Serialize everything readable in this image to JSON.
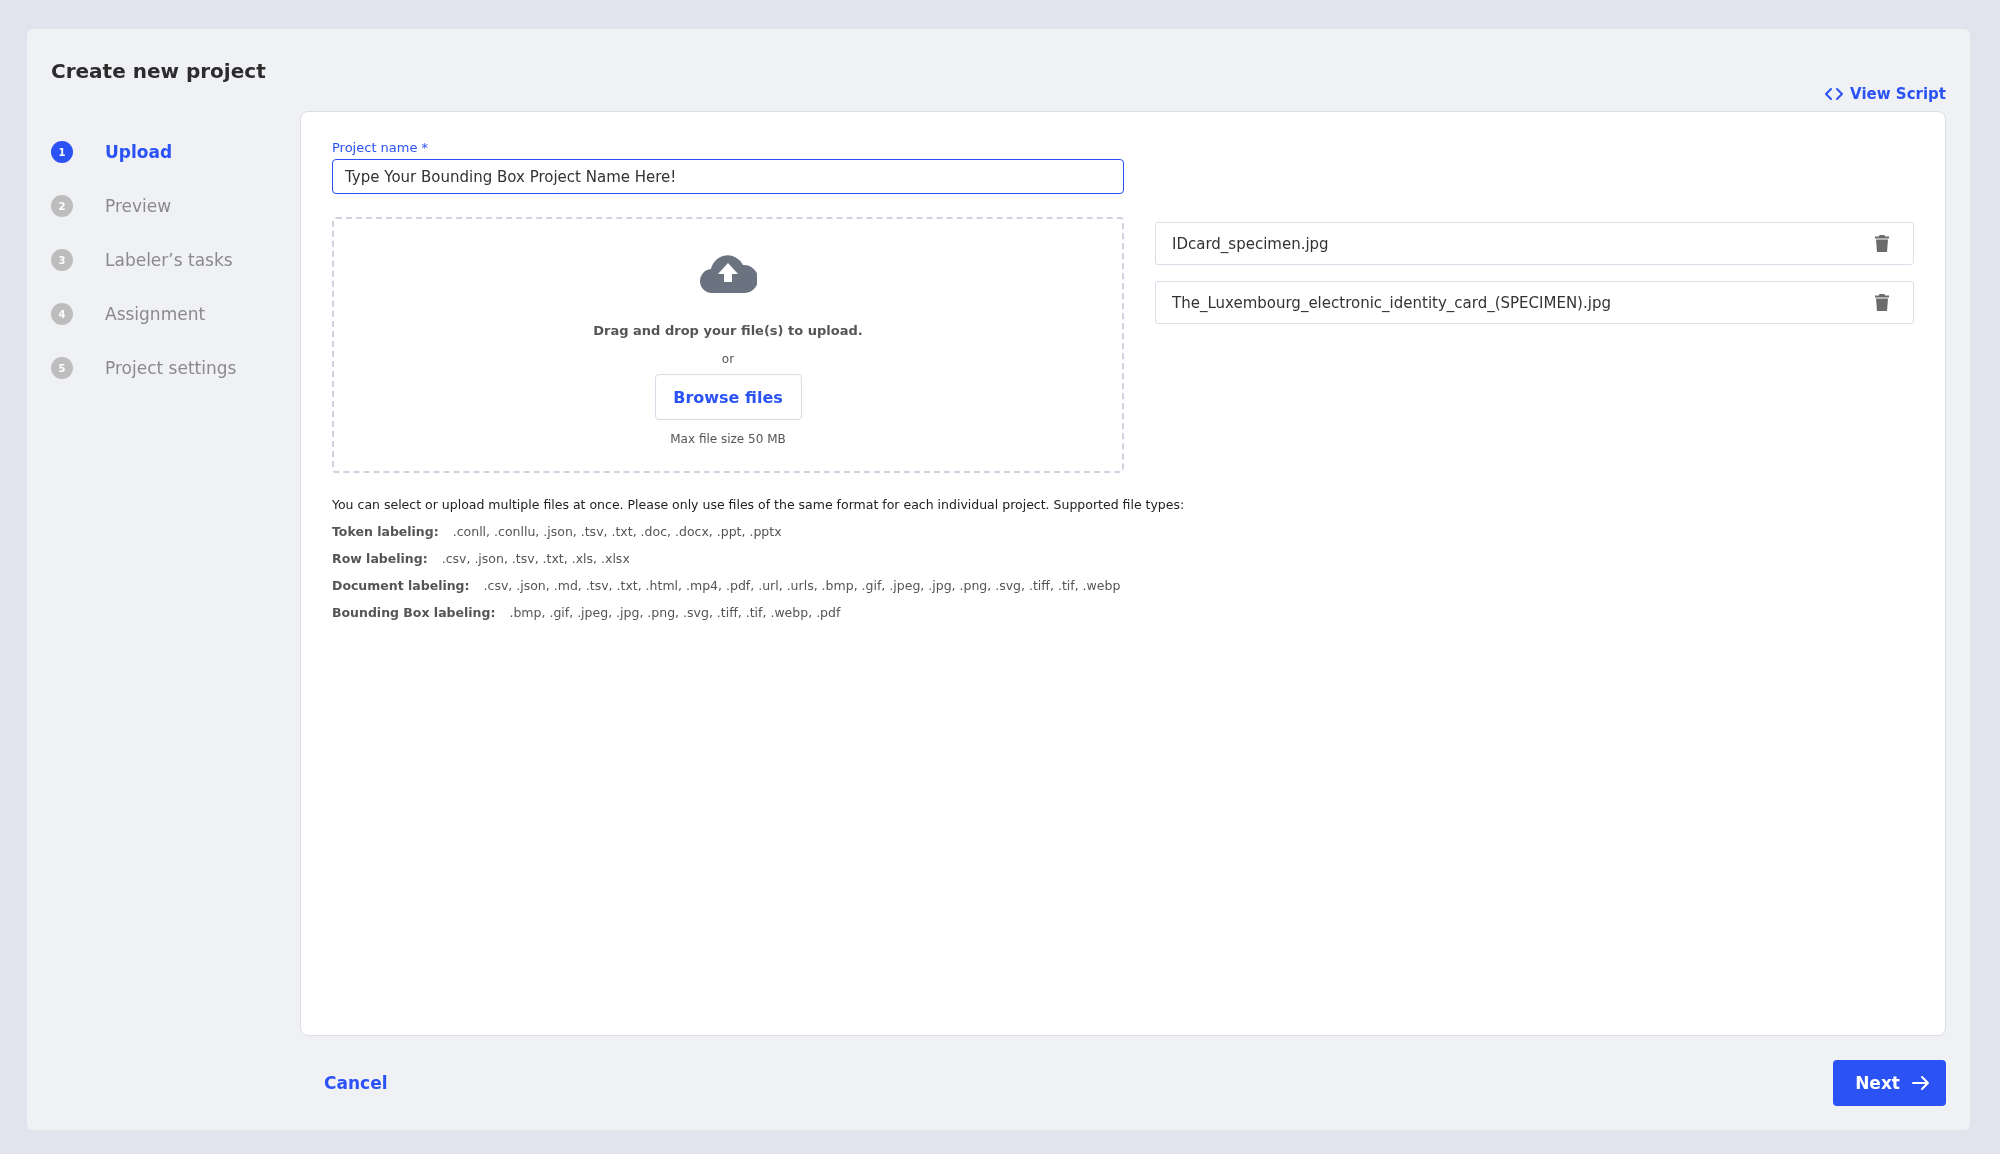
{
  "title": "Create new project",
  "view_script": "View Script",
  "steps": [
    {
      "number": "1",
      "label": "Upload",
      "selected": true
    },
    {
      "number": "2",
      "label": "Preview",
      "selected": false
    },
    {
      "number": "3",
      "label": "Labeler’s tasks",
      "selected": false
    },
    {
      "number": "4",
      "label": "Assignment",
      "selected": false
    },
    {
      "number": "5",
      "label": "Project settings",
      "selected": false
    }
  ],
  "project_name": {
    "label": "Project name *",
    "value": "Type Your Bounding Box Project Name Here!"
  },
  "dropzone": {
    "instruction": "Drag and drop your file(s) to upload.",
    "separator": "or",
    "button": "Browse files",
    "limit": "Max file size 50 MB"
  },
  "files": [
    "IDcard_specimen.jpg",
    "The_Luxembourg_electronic_identity_card_(SPECIMEN).jpg"
  ],
  "info": "You can select or upload multiple files at once. Please only use files of the same format for each individual project. Supported file types:",
  "file_types": [
    {
      "label": "Token labeling:",
      "types": ".conll, .conllu, .json, .tsv, .txt, .doc, .docx, .ppt, .pptx"
    },
    {
      "label": "Row labeling:",
      "types": ".csv, .json, .tsv, .txt, .xls, .xlsx"
    },
    {
      "label": "Document labeling:",
      "types": ".csv, .json, .md, .tsv, .txt, .html, .mp4, .pdf, .url, .urls, .bmp, .gif, .jpeg, .jpg, .png, .svg, .tiff, .tif, .webp"
    },
    {
      "label": "Bounding Box labeling:",
      "types": ".bmp, .gif, .jpeg, .jpg, .png, .svg, .tiff, .tif, .webp, .pdf"
    }
  ],
  "footer": {
    "cancel": "Cancel",
    "next": "Next"
  }
}
